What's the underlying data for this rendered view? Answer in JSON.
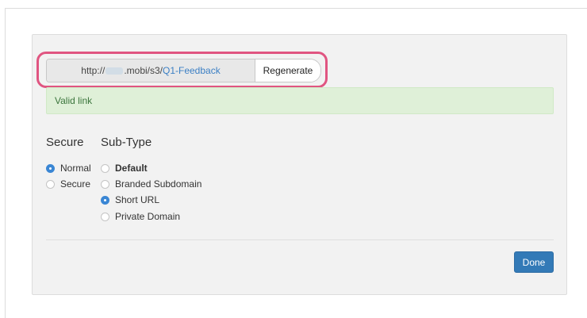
{
  "link": {
    "url_prefix": "http://",
    "url_middle": ".mobi/s3/",
    "url_slug": "Q1-Feedback",
    "regenerate_label": "Regenerate"
  },
  "alert": {
    "text": "Valid link"
  },
  "secure": {
    "heading": "Secure",
    "options": [
      {
        "label": "Normal",
        "selected": true
      },
      {
        "label": "Secure",
        "selected": false
      }
    ]
  },
  "subtype": {
    "heading": "Sub-Type",
    "options": [
      {
        "label": "Default",
        "selected": false
      },
      {
        "label": "Branded Subdomain",
        "selected": false
      },
      {
        "label": "Short URL",
        "selected": true
      },
      {
        "label": "Private Domain",
        "selected": false
      }
    ]
  },
  "footer": {
    "done_label": "Done"
  },
  "colors": {
    "accent": "#337ab7",
    "highlight": "#e05581",
    "alert_bg": "#dff0d8",
    "alert_text": "#3c763d"
  }
}
